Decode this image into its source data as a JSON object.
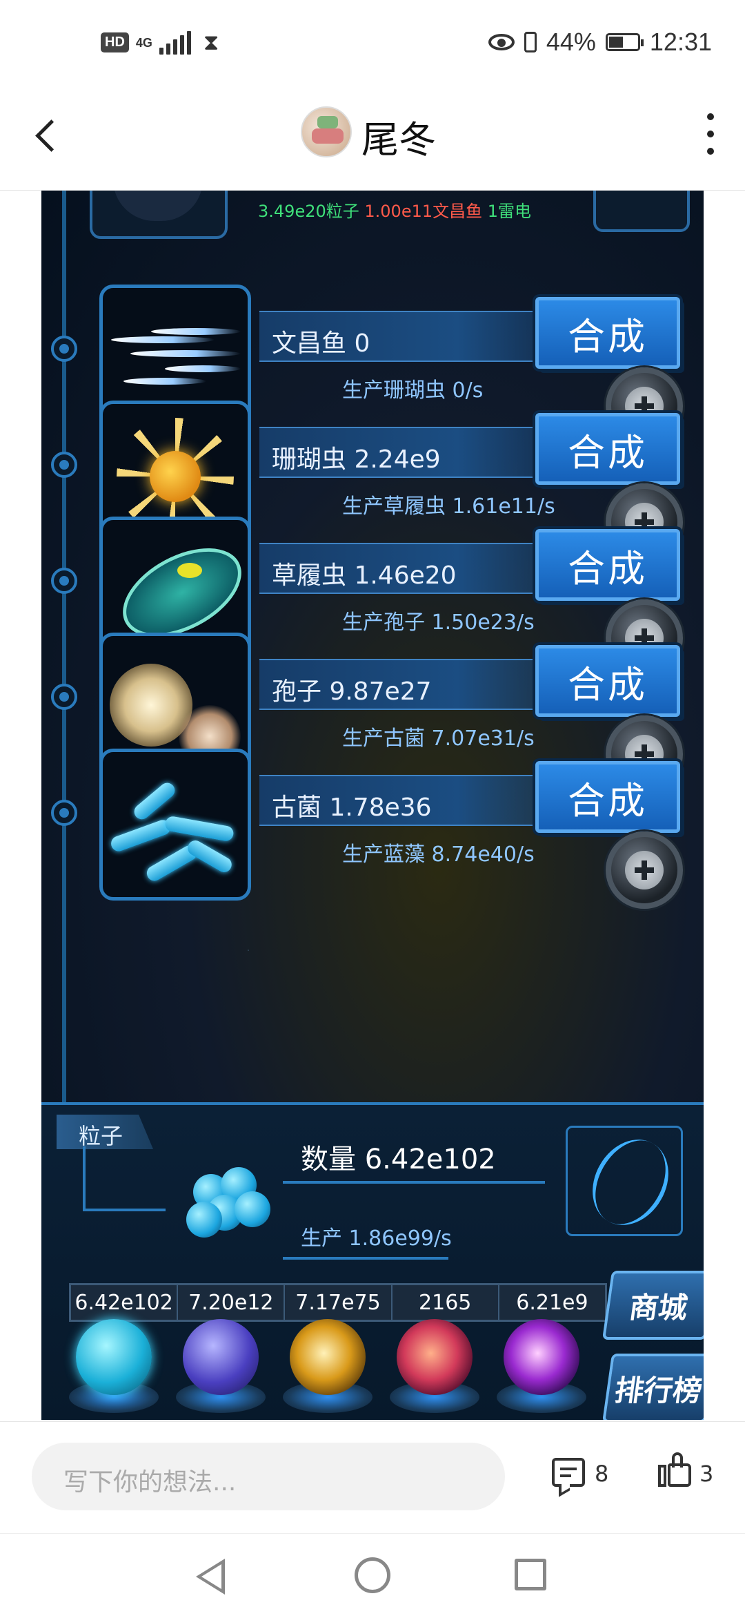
{
  "status_bar": {
    "network_hd": "HD",
    "network_4g": "4G",
    "battery_percent": "44%",
    "time": "12:31"
  },
  "header": {
    "title": "尾冬"
  },
  "game": {
    "resources": {
      "particle": "3.49e20粒子",
      "fish": "1.00e11文昌鱼",
      "thunder": "1雷电"
    },
    "creatures": [
      {
        "name": "文昌鱼 0",
        "production": "生产珊瑚虫 0/s",
        "synth_label": "合成",
        "icon": "lancelet-icon"
      },
      {
        "name": "珊瑚虫 2.24e9",
        "production": "生产草履虫 1.61e11/s",
        "synth_label": "合成",
        "icon": "coral-polyp-icon"
      },
      {
        "name": "草履虫 1.46e20",
        "production": "生产孢子 1.50e23/s",
        "synth_label": "合成",
        "icon": "paramecium-icon"
      },
      {
        "name": "孢子 9.87e27",
        "production": "生产古菌 7.07e31/s",
        "synth_label": "合成",
        "icon": "spore-icon"
      },
      {
        "name": "古菌 1.78e36",
        "production": "生产蓝藻 8.74e40/s",
        "synth_label": "合成",
        "icon": "archaea-icon"
      }
    ],
    "particle_panel": {
      "tag": "粒子",
      "count": "数量 6.42e102",
      "production": "生产 1.86e99/s"
    },
    "stats": [
      "6.42e102",
      "7.20e12",
      "7.17e75",
      "2165",
      "6.21e9"
    ],
    "orbs": [
      "particle-orb-icon",
      "thunder-orb-icon",
      "galaxy-orb-icon",
      "brain-orb-icon",
      "vortex-orb-icon"
    ],
    "side_buttons": {
      "shop": "商城",
      "ranking": "排行榜"
    }
  },
  "comment_bar": {
    "placeholder": "写下你的想法...",
    "comment_count": "8",
    "like_count": "3"
  }
}
